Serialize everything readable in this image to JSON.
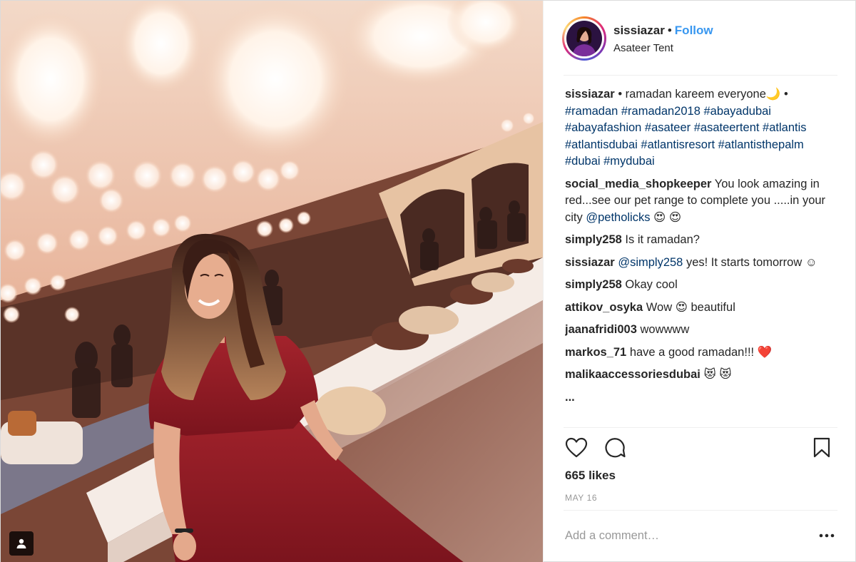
{
  "post": {
    "username": "sissiazar",
    "separator": "•",
    "follow_label": "Follow",
    "location": "Asateer Tent",
    "caption": {
      "username": "sissiazar",
      "text_before": " • ramadan kareem everyone🌙 • ",
      "hashtags": "#ramadan #ramadan2018 #abayadubai #abayafashion #asateer #asateertent #atlantis #atlantisdubai #atlantisresort #atlantisthepalm #dubai #mydubai"
    },
    "comments": [
      {
        "user": "social_media_shopkeeper",
        "text": " You look amazing in red...see our pet range to complete you .....in your city ",
        "mention": "@petholicks",
        "after": " 😍 😍"
      },
      {
        "user": "simply258",
        "text": " Is it ramadan?",
        "mention": "",
        "after": ""
      },
      {
        "user": "sissiazar",
        "text": " ",
        "mention": "@simply258",
        "after": " yes! It starts tomorrow ☺"
      },
      {
        "user": "simply258",
        "text": " Okay cool",
        "mention": "",
        "after": ""
      },
      {
        "user": "attikov_osyka",
        "text": " Wow 😍  beautiful",
        "mention": "",
        "after": ""
      },
      {
        "user": "jaanafridi003",
        "text": " wowwww",
        "mention": "",
        "after": ""
      },
      {
        "user": "markos_71",
        "text": " have a good ramadan!!! ❤️",
        "mention": "",
        "after": ""
      },
      {
        "user": "malikaaccessoriesdubai",
        "text": " 😻 😻",
        "mention": "",
        "after": ""
      },
      {
        "user": "...",
        "text": " ",
        "mention": "",
        "after": ""
      }
    ],
    "likes": "665 likes",
    "date": "MAY 16",
    "add_comment_placeholder": "Add a comment…",
    "icons": {
      "like": "heart-icon",
      "comment": "comment-bubble-icon",
      "save": "bookmark-icon",
      "more": "more-options-icon",
      "tag": "user-tag-icon"
    },
    "colors": {
      "link": "#003569",
      "follow": "#3897f0",
      "text": "#262626",
      "muted": "#999999"
    }
  }
}
